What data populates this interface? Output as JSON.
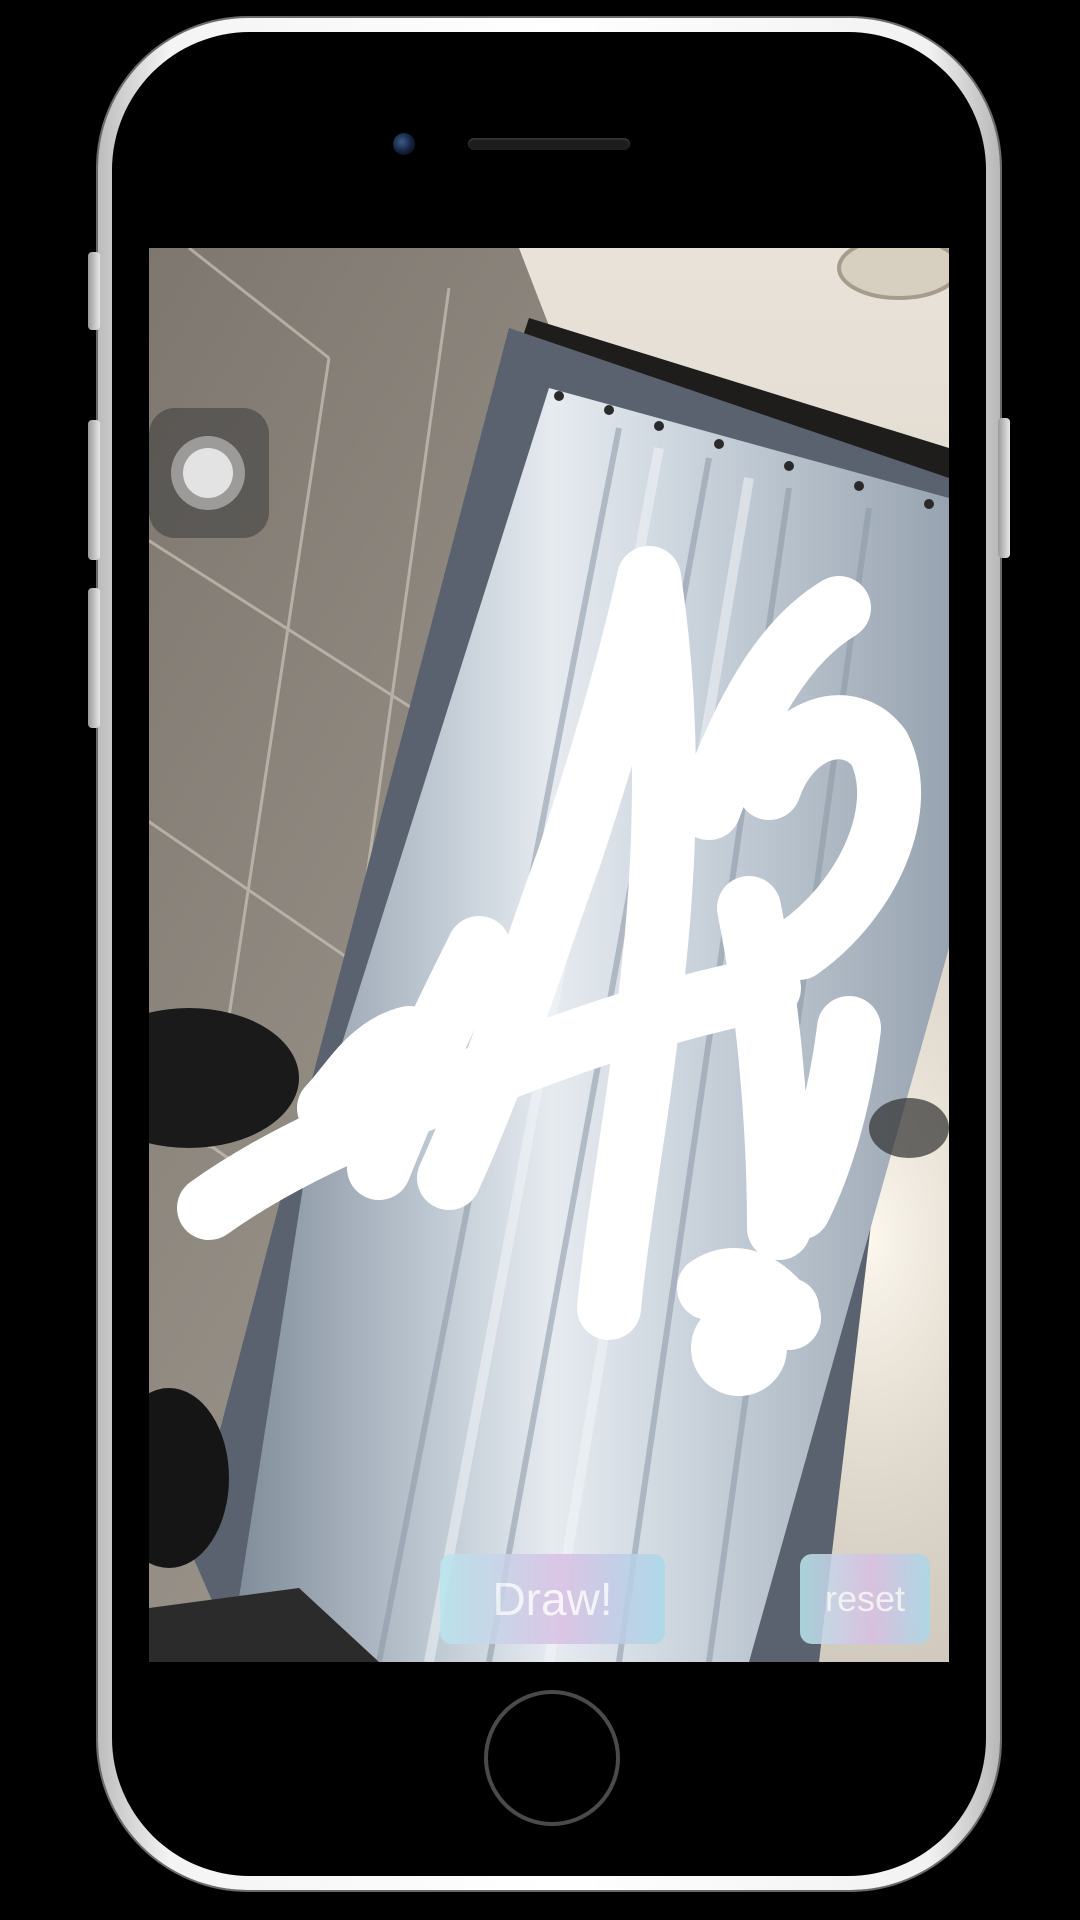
{
  "app": {
    "buttons": {
      "draw_label": "Draw!",
      "reset_label": "reset"
    },
    "drawing": {
      "text": "AR!",
      "stroke_color": "#ffffff"
    },
    "colors": {
      "button_gradient_start": "#b9e6ee",
      "button_gradient_mid": "#d9bfe3",
      "button_gradient_end": "#a9d9ea",
      "device_frame": "#f4f4f4",
      "background": "#000000"
    },
    "icons": {
      "assistive_touch": "assistive-touch-icon",
      "home": "home-button",
      "camera": "front-camera-icon",
      "speaker": "speaker-grille"
    }
  }
}
